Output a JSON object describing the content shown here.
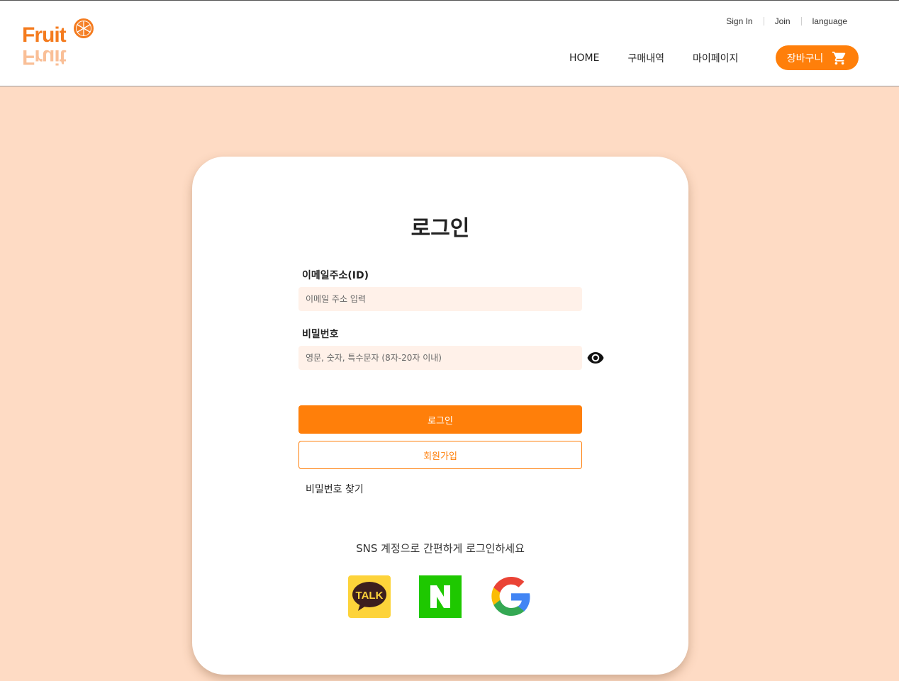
{
  "header": {
    "logo": {
      "text": "Fruit",
      "icon": "orange-slice-icon"
    },
    "util_nav": [
      "Sign In",
      "Join",
      "language"
    ],
    "main_nav": [
      "HOME",
      "구매내역",
      "마이페이지"
    ],
    "cart": {
      "label": "장바구니",
      "icon": "cart-icon"
    }
  },
  "login": {
    "title": "로그인",
    "email": {
      "label": "이메일주소(ID)",
      "placeholder": "이메일 주소 입력",
      "value": ""
    },
    "password": {
      "label": "비밀번호",
      "placeholder": "영문, 숫자, 특수문자 (8자-20자 이내)",
      "value": "",
      "toggle_icon": "eye-icon"
    },
    "login_button": "로그인",
    "join_button": "회원가입",
    "find_password": "비밀번호 찾기",
    "sns_text": "SNS 계정으로 간편하게 로그인하세요",
    "sns": [
      {
        "name": "kakao",
        "label": "TALK",
        "icon": "kakao-talk-icon"
      },
      {
        "name": "naver",
        "label": "N",
        "icon": "naver-icon"
      },
      {
        "name": "google",
        "label": "G",
        "icon": "google-icon"
      }
    ]
  },
  "colors": {
    "accent": "#ff7f0a",
    "background": "#fedbc4",
    "input_bg": "#fff1e9",
    "kakao": "#fdd33a",
    "naver": "#1ec800"
  }
}
